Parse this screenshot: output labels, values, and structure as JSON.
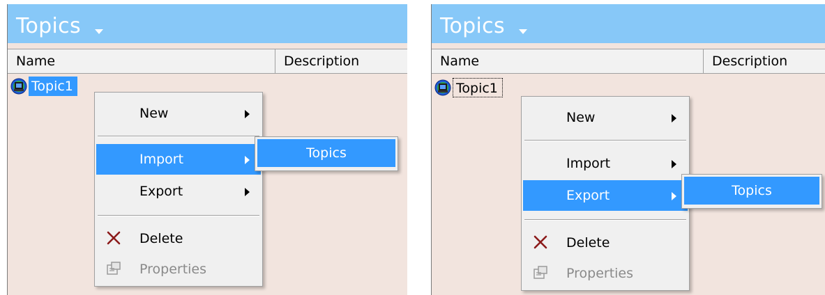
{
  "panels": [
    {
      "title": "Topics",
      "columns": {
        "name": "Name",
        "description": "Description"
      },
      "item": {
        "label": "Topic1",
        "selected": true
      },
      "menu": {
        "new": "New",
        "import": "Import",
        "export": "Export",
        "delete": "Delete",
        "properties": "Properties",
        "highlighted": "Import"
      },
      "submenu": {
        "item": "Topics"
      }
    },
    {
      "title": "Topics",
      "columns": {
        "name": "Name",
        "description": "Description"
      },
      "item": {
        "label": "Topic1",
        "selected": false
      },
      "menu": {
        "new": "New",
        "import": "Import",
        "export": "Export",
        "delete": "Delete",
        "properties": "Properties",
        "highlighted": "Export"
      },
      "submenu": {
        "item": "Topics"
      }
    }
  ],
  "colors": {
    "titlebar": "#87c8f8",
    "selection": "#3399ff",
    "background": "#f2e4de",
    "delete_icon": "#8b1a1a"
  }
}
